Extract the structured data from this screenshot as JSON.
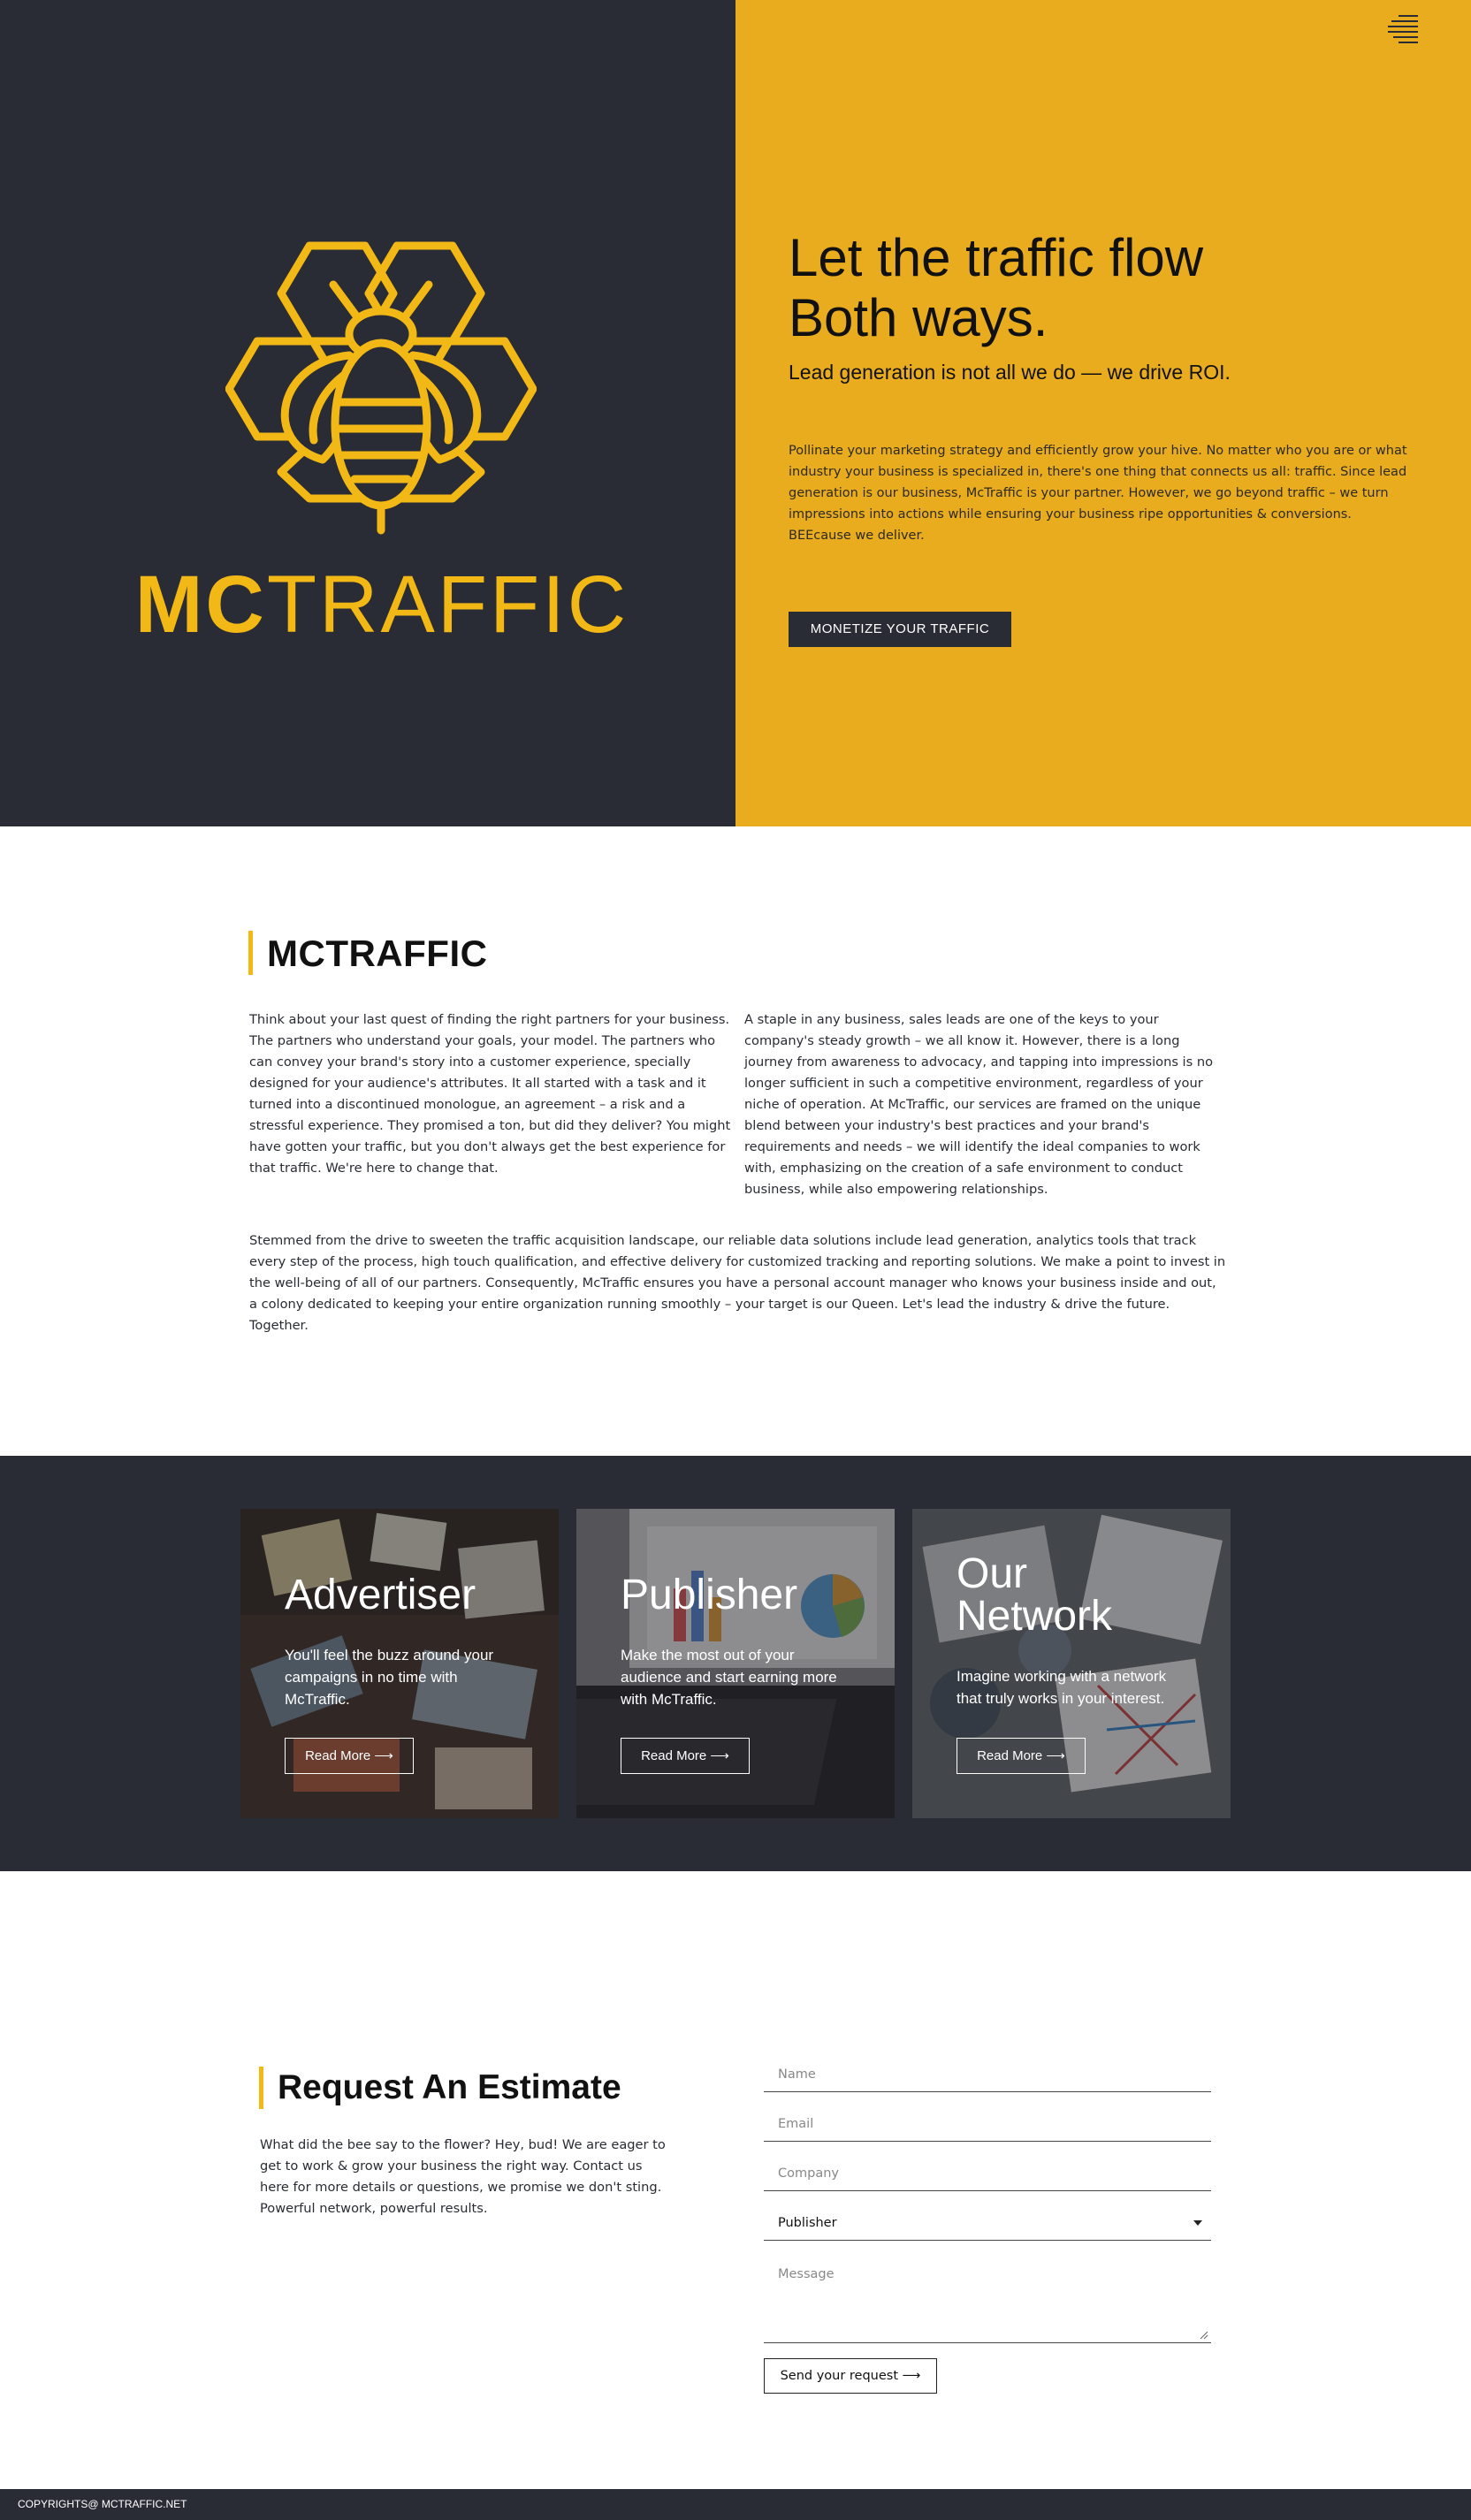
{
  "brand": {
    "logo_mc": "MC",
    "logo_traffic": "TRAFFIC",
    "logo_icon": "bee-hexagon-icon",
    "accent": "#f2b815",
    "dark": "#2a2c35",
    "yellow_panel": "#e9ac1e"
  },
  "nav": {
    "menu_icon": "hamburger-menu-icon"
  },
  "hero": {
    "title_line1": "Let the traffic flow",
    "title_line2": "Both ways.",
    "subtitle": "Lead generation is not all we do — we drive ROI.",
    "body": "Pollinate your marketing strategy and efficiently grow your hive. No matter who you are or what industry your business is specialized in, there's one thing that connects us all: traffic. Since lead generation is our business, McTraffic is your partner. However, we go beyond traffic – we turn impressions into actions while ensuring your business ripe opportunities & conversions. BEEcause we deliver.",
    "cta_label": "MONETIZE YOUR TRAFFIC"
  },
  "about": {
    "title": "MCTRAFFIC",
    "col1": "Think about your last quest of finding the right partners for your business. The partners who understand your goals, your model. The partners who can convey your brand's story into a customer experience, specially designed for your audience's attributes. It all started with a task and it turned into a discontinued monologue, an agreement – a risk and a stressful experience. They promised a ton, but did they deliver? You might have gotten your traffic, but you don't always get the best experience for that traffic. We're here to change that.",
    "col2": "A staple in any business, sales leads are one of the keys to your company's steady growth – we all know it. However, there is a long journey from awareness to advocacy, and tapping into impressions is no longer sufficient in such a competitive environment, regardless of your niche of operation. At McTraffic, our services are framed on the unique blend between your industry's best practices and your brand's requirements and needs – we will identify the ideal companies to work with, emphasizing on the creation of a safe environment to conduct business, while also empowering relationships.",
    "full": "Stemmed from the drive to sweeten the traffic acquisition landscape, our reliable data solutions include lead generation, analytics tools that track every step of the process, high touch qualification, and effective delivery for customized tracking and reporting solutions. We make a point to invest in the well-being of all of our partners. Consequently, McTraffic ensures you have a personal account manager who knows your business inside and out, a colony dedicated to keeping your entire organization running smoothly – your target is our Queen. Let's lead the industry & drive the future. Together."
  },
  "cards": [
    {
      "title": "Advertiser",
      "desc": "You'll feel the buzz around your campaigns in no time with McTraffic.",
      "button": "Read More ⟶"
    },
    {
      "title": "Publisher",
      "desc": "Make the most out of your audience and start earning more with McTraffic.",
      "button": "Read More ⟶"
    },
    {
      "title_line1": "Our",
      "title_line2": "Network",
      "desc": "Imagine working with a network that truly works in your interest.",
      "button": "Read More ⟶"
    }
  ],
  "estimate": {
    "title": "Request An Estimate",
    "text": "What did the bee say to the flower? Hey, bud! We are eager to get to work & grow your business the right way. Contact us here for more details or questions, we promise we don't sting. Powerful network, powerful results.",
    "name_placeholder": "Name",
    "email_placeholder": "Email",
    "company_placeholder": "Company",
    "select_value": "Publisher",
    "message_placeholder": "Message",
    "send_label": "Send your request ⟶"
  },
  "footer": {
    "copyright": "COPYRIGHTS@ MCTRAFFIC.NET"
  }
}
